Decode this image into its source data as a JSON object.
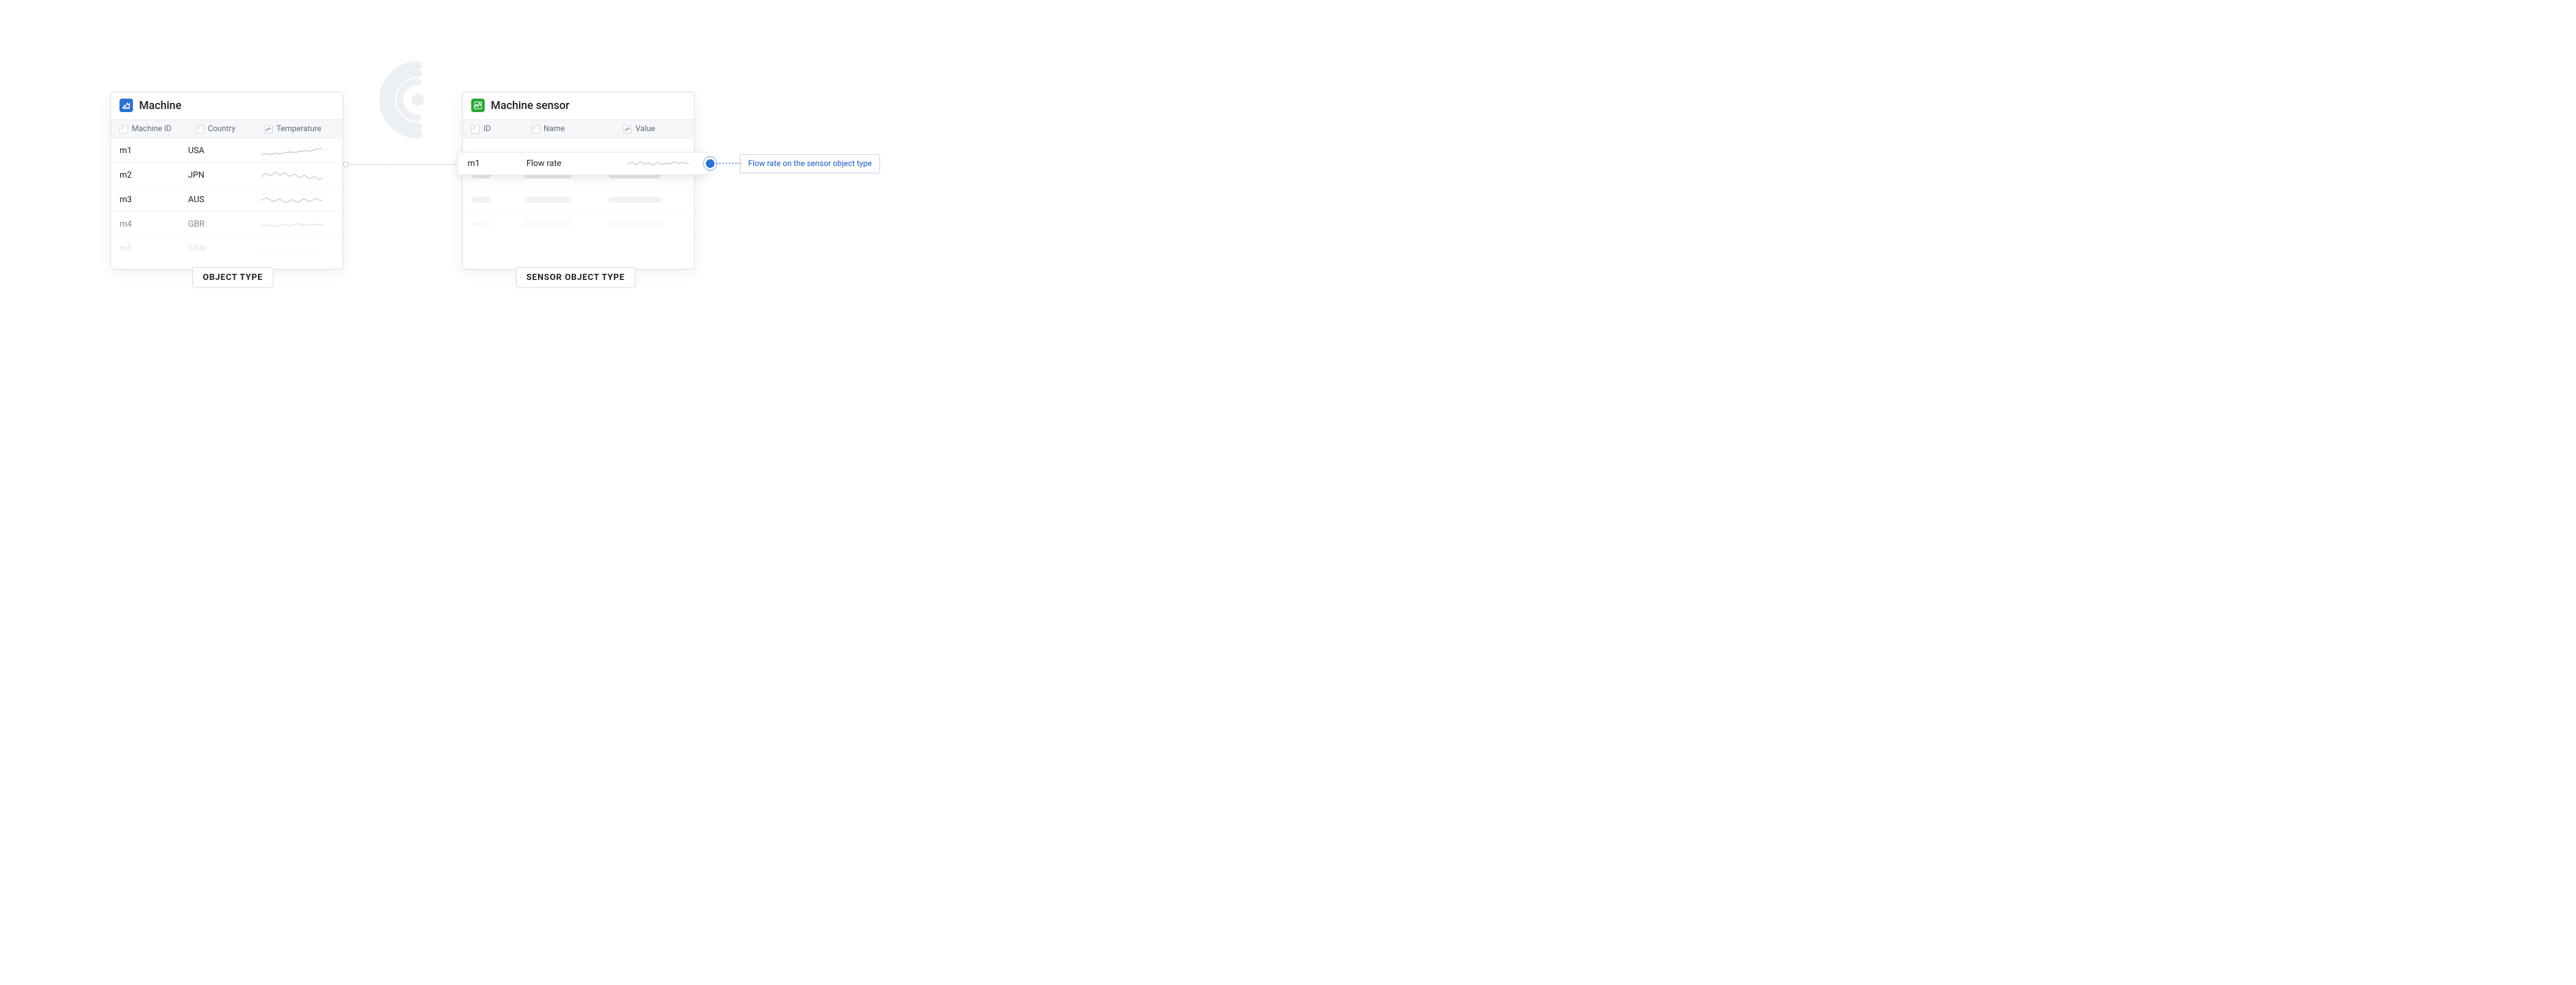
{
  "left_card": {
    "title": "Machine",
    "columns": [
      "Machine ID",
      "Country",
      "Temperature"
    ],
    "rows": [
      {
        "id": "m1",
        "country": "USA"
      },
      {
        "id": "m2",
        "country": "JPN"
      },
      {
        "id": "m3",
        "country": "AUS"
      },
      {
        "id": "m4",
        "country": "GBR"
      },
      {
        "id": "m5",
        "country": "CAN"
      }
    ],
    "label": "Object type"
  },
  "right_card": {
    "title": "Machine sensor",
    "columns": [
      "ID",
      "Name",
      "Value"
    ],
    "highlight": {
      "id": "m1",
      "name": "Flow rate"
    },
    "label": "Sensor object type"
  },
  "callout": "Flow rate on the sensor object type"
}
